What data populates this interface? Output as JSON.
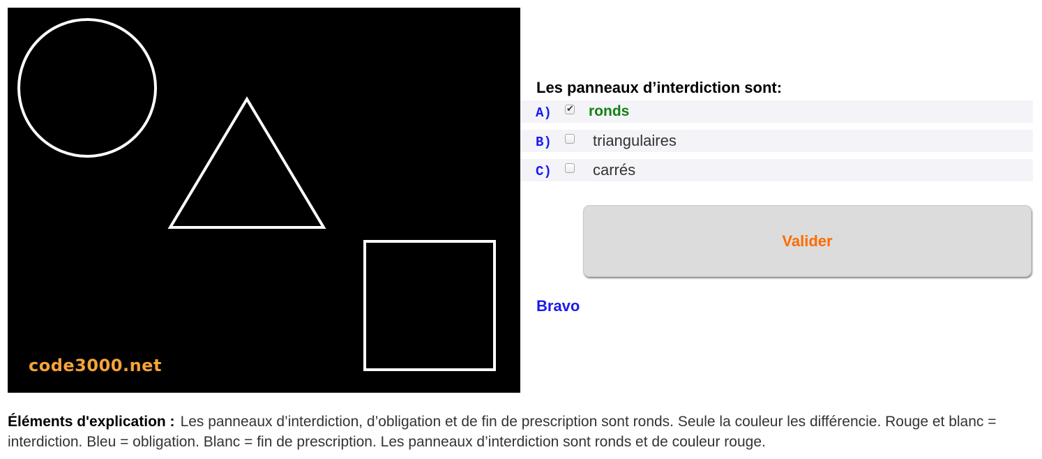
{
  "image": {
    "watermark": "code3000.net",
    "background_color": "#000000",
    "shape_color": "#ffffff",
    "watermark_color": "#f5a33a"
  },
  "question": {
    "title": "Les panneaux d’interdiction sont:",
    "answers": [
      {
        "letter": "A)",
        "text": "ronds",
        "checked": true,
        "correct": true
      },
      {
        "letter": "B)",
        "text": "triangulaires",
        "checked": false,
        "correct": false
      },
      {
        "letter": "C)",
        "text": "carrés",
        "checked": false,
        "correct": false
      }
    ],
    "validate_label": "Valider",
    "feedback": "Bravo"
  },
  "explanation": {
    "label": "Éléments d'explication :",
    "text": "Les panneaux d’interdiction, d’obligation et de fin de prescription sont ronds. Seule la couleur les différencie. Rouge et blanc = interdiction. Bleu = obligation. Blanc = fin de prescription. Les panneaux d’interdiction sont ronds et de couleur rouge."
  },
  "colors": {
    "letter": "#1a1af0",
    "correct_answer": "#138113",
    "button_text": "#ff6a00",
    "feedback": "#1a1af0",
    "row_background": "#f4f3f8"
  }
}
